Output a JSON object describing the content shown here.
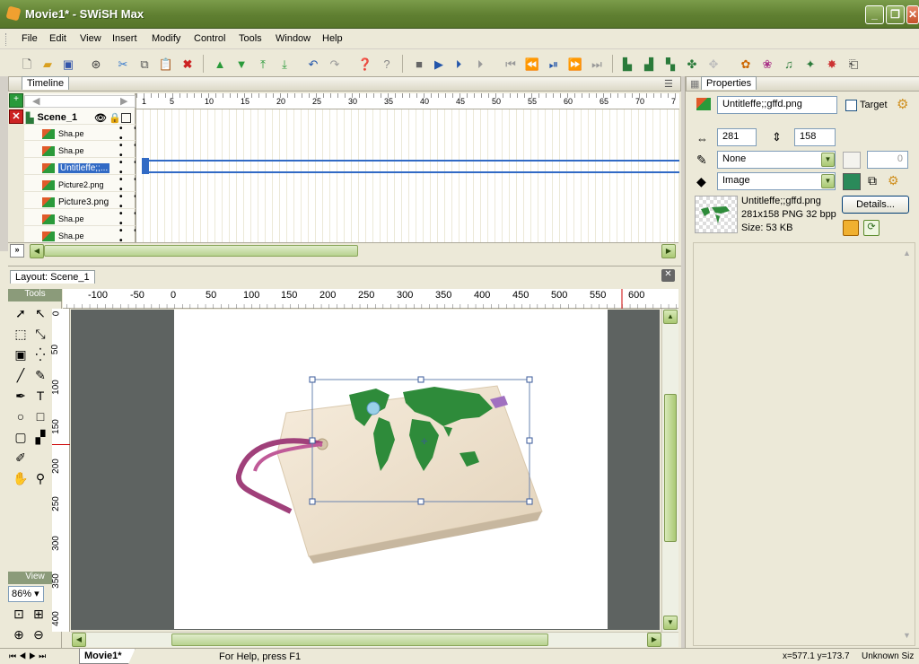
{
  "window": {
    "title": "Movie1* - SWiSH Max",
    "min": "_",
    "max": "❐",
    "close": "✕"
  },
  "menu": [
    "File",
    "Edit",
    "View",
    "Insert",
    "Modify",
    "Control",
    "Tools",
    "Window",
    "Help"
  ],
  "timeline": {
    "tab": "Timeline",
    "scene": "Scene_1",
    "layers": [
      {
        "name": "Sha.pe"
      },
      {
        "name": "Sha.pe"
      },
      {
        "name": "Untitleffe;;..."
      },
      {
        "name": "Picture2.png"
      },
      {
        "name": "Picture3.png"
      },
      {
        "name": "Sha.pe"
      },
      {
        "name": "Sha.pe"
      }
    ],
    "layer_dots": "• • •",
    "ruler_ticks": [
      "1",
      "5",
      "10",
      "15",
      "20",
      "25",
      "30",
      "35",
      "40",
      "45",
      "50",
      "55",
      "60",
      "65",
      "70",
      "7"
    ]
  },
  "layout": {
    "tab": "Layout: Scene_1",
    "tools_label": "Tools",
    "view_label": "View",
    "zoom": "86%",
    "hruler": [
      "-100",
      "-50",
      "0",
      "50",
      "100",
      "150",
      "200",
      "250",
      "300",
      "350",
      "400",
      "450",
      "500",
      "550",
      "600"
    ],
    "vruler": [
      "0",
      "50",
      "100",
      "150",
      "200",
      "250",
      "300",
      "350",
      "400"
    ]
  },
  "properties": {
    "tab": "Properties",
    "name": "Untitleffe;;gffd.png",
    "target_label": "Target",
    "width": "281",
    "height": "158",
    "line_style": "None",
    "fill_style": "Image",
    "opacity": "0",
    "image_name": "Untitleffe;;gffd.png",
    "image_info": "281x158 PNG 32 bpp",
    "image_size": "Size: 53 KB",
    "details_button": "Details..."
  },
  "status": {
    "doc_tab": "Movie1*",
    "help": "For Help, press F1",
    "coords": "x=577.1 y=173.7",
    "unit": "Unknown Siz"
  },
  "colors": {
    "accent": "#5f7f31",
    "selection": "#316ac5",
    "continent": "#2e8b3a",
    "tag": "#efe3cf"
  }
}
